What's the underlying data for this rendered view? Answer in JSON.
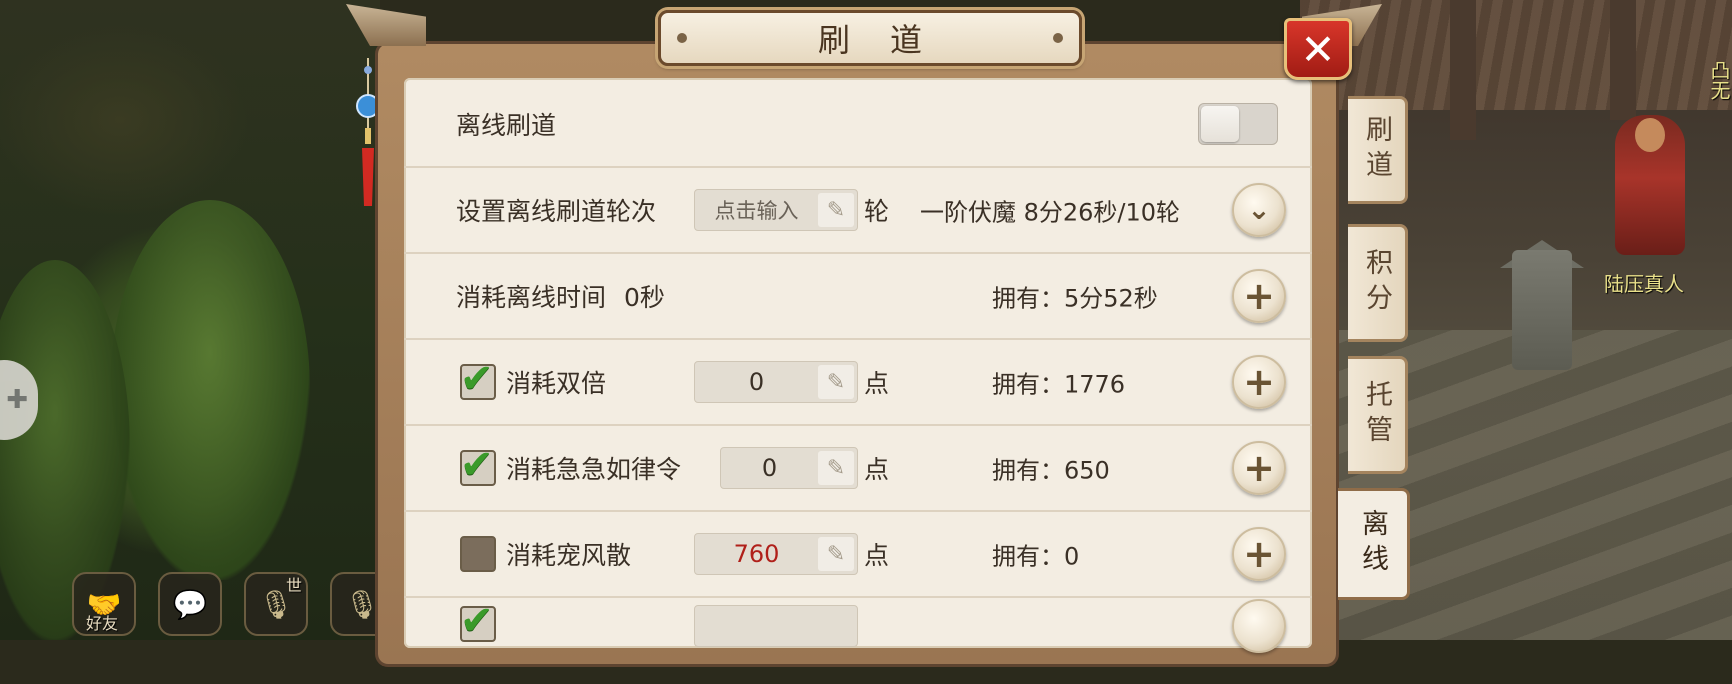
{
  "dialog": {
    "title": "刷道",
    "close_label": "✕"
  },
  "rows": {
    "offline_toggle": {
      "label": "离线刷道",
      "enabled": false
    },
    "set_rounds": {
      "label": "设置离线刷道轮次",
      "placeholder": "点击输入",
      "unit": "轮",
      "info": "一阶伏魔 8分26秒/10轮"
    },
    "consume_time": {
      "label": "消耗离线时间",
      "value": "0秒",
      "owned": "拥有：5分52秒"
    },
    "double": {
      "label": "消耗双倍",
      "checked": true,
      "value": "0",
      "unit": "点",
      "owned": "拥有：1776"
    },
    "jijirulvling": {
      "label": "消耗急急如律令",
      "checked": true,
      "value": "0",
      "unit": "点",
      "owned": "拥有：650"
    },
    "pet_wind": {
      "label": "消耗宠风散",
      "checked": false,
      "value": "760",
      "unit": "点",
      "owned": "拥有：0"
    }
  },
  "tabs": [
    {
      "label": "刷道",
      "active": false
    },
    {
      "label": "积分",
      "active": false
    },
    {
      "label": "托管",
      "active": false
    },
    {
      "label": "离线",
      "active": true
    }
  ],
  "hud": {
    "friends_label": "好友",
    "world_label": "世"
  },
  "world": {
    "npc_name": "陆压真人",
    "npc_top_text": "凸无"
  },
  "icons": {
    "pencil": "pencil-icon",
    "expand": "chevron-down-icon",
    "add": "plus-icon",
    "check": "checkmark-icon"
  },
  "colors": {
    "panel_bg": "#f3ede2",
    "close_red": "#c22a20",
    "highlight_value": "#b0201a",
    "check_green": "#3a9a2a"
  }
}
